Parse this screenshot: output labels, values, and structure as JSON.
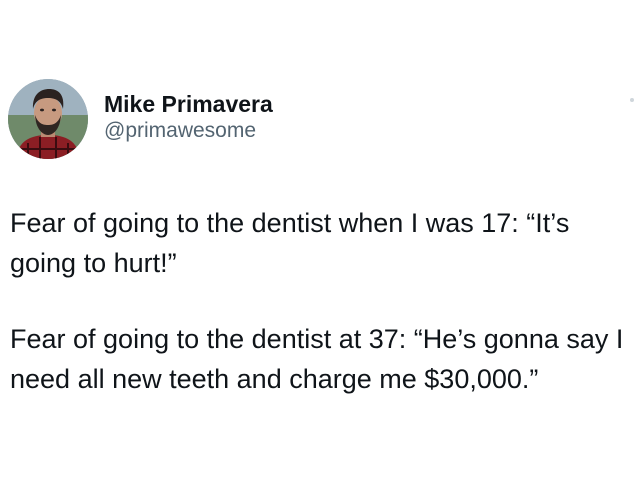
{
  "author": {
    "display_name": "Mike Primavera",
    "handle": "@primawesome",
    "avatar_icon": "profile-photo"
  },
  "tweet": {
    "paragraphs": [
      "Fear of going to the dentist when I was 17: “It’s going to hurt!”",
      "Fear of going to the dentist at 37: “He’s gonna say I need all new teeth and charge me $30,000.”"
    ]
  },
  "colors": {
    "background": "#ffffff",
    "text": "#0f1419",
    "handle": "#536471"
  }
}
